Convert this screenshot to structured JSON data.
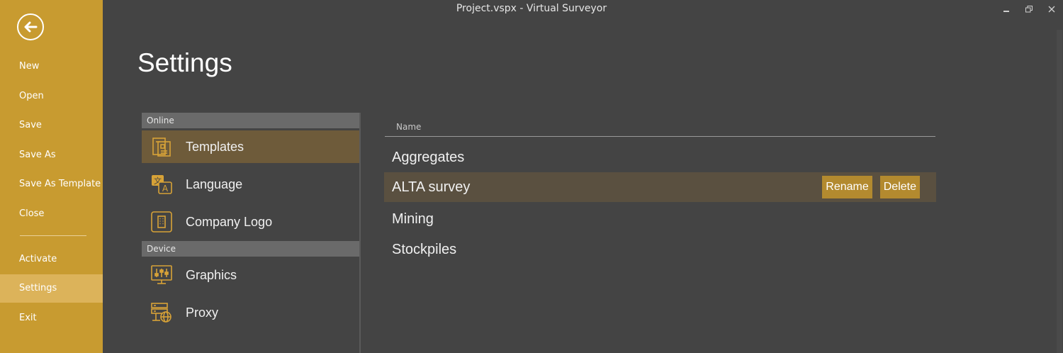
{
  "window": {
    "title": "Project.vspx  -  Virtual Surveyor"
  },
  "sidebar": {
    "back_icon": "arrow-left-circle-icon",
    "items": [
      {
        "label": "New"
      },
      {
        "label": "Open"
      },
      {
        "label": "Save"
      },
      {
        "label": "Save As"
      },
      {
        "label": "Save As Template"
      },
      {
        "label": "Close"
      },
      {
        "label": "Activate"
      },
      {
        "label": "Settings",
        "selected": true
      },
      {
        "label": "Exit"
      }
    ]
  },
  "page": {
    "title": "Settings"
  },
  "categories": {
    "groups": [
      {
        "header": "Online",
        "items": [
          {
            "label": "Templates",
            "icon": "templates-icon",
            "selected": true
          },
          {
            "label": "Language",
            "icon": "language-icon"
          },
          {
            "label": "Company Logo",
            "icon": "company-logo-icon"
          }
        ]
      },
      {
        "header": "Device",
        "items": [
          {
            "label": "Graphics",
            "icon": "graphics-sliders-icon"
          },
          {
            "label": "Proxy",
            "icon": "proxy-server-globe-icon"
          }
        ]
      }
    ]
  },
  "templates": {
    "column_header": "Name",
    "rows": [
      {
        "name": "Aggregates"
      },
      {
        "name": "ALTA survey",
        "rename_label": "Rename",
        "delete_label": "Delete"
      },
      {
        "name": "Mining"
      },
      {
        "name": "Stockpiles"
      }
    ]
  },
  "colors": {
    "sidebar_bg": "#c89b30",
    "sidebar_selected": "#dcb35a",
    "content_bg": "#444444",
    "selected_category": "#6e5b3a",
    "row_hover": "#5a5040",
    "accent_button": "#b38a2f",
    "icon_accent": "#d7a237"
  }
}
